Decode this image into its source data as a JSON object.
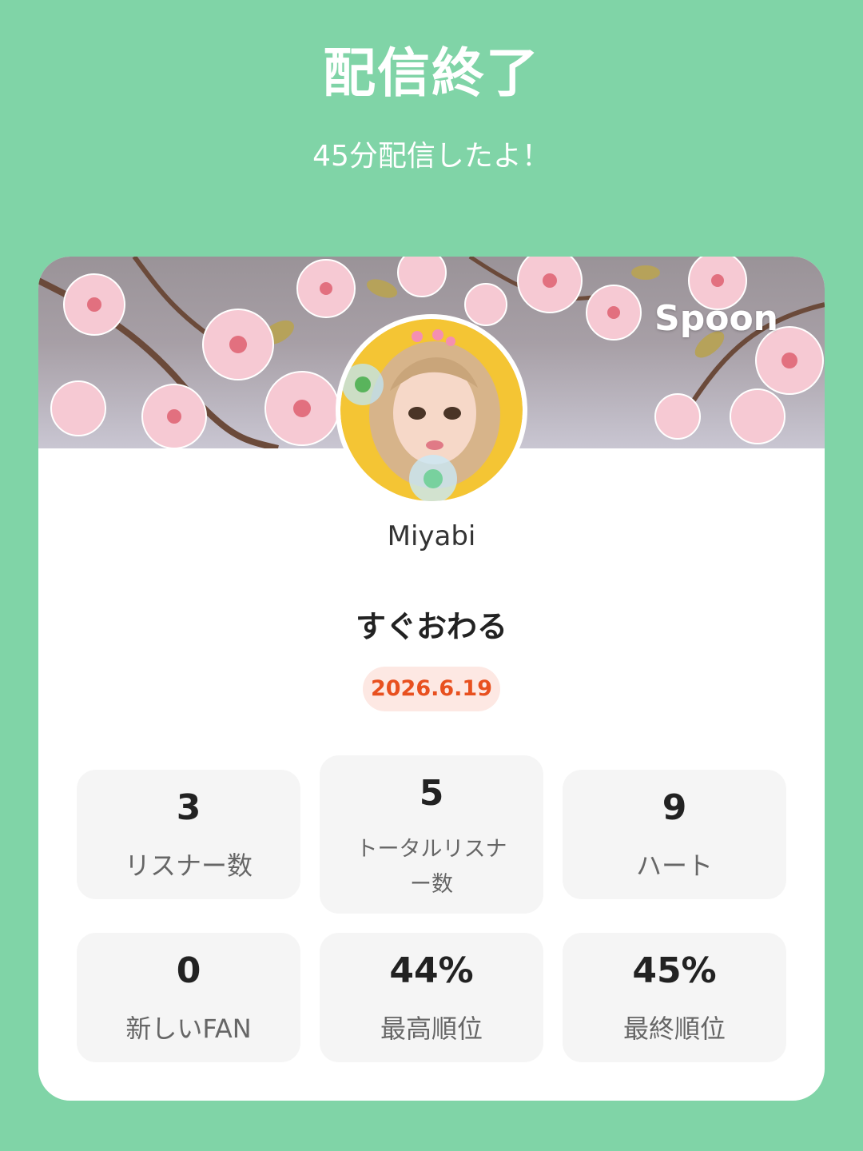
{
  "header": {
    "title": "配信終了",
    "subtitle": "45分配信したよ！"
  },
  "card": {
    "brand": "Spoon",
    "username": "Miyabi",
    "broadcast_title": "すぐおわる",
    "date": "2026.6.19",
    "stats": [
      {
        "value": "3",
        "label": "リスナー数"
      },
      {
        "value": "5",
        "label": "トータルリスナー数"
      },
      {
        "value": "9",
        "label": "ハート"
      },
      {
        "value": "0",
        "label": "新しいFAN"
      },
      {
        "value": "44%",
        "label": "最高順位"
      },
      {
        "value": "45%",
        "label": "最終順位"
      }
    ]
  },
  "colors": {
    "background": "#80d4a7",
    "card": "#ffffff",
    "stat_tile": "#f5f5f5",
    "date_badge_bg": "#fde8e3",
    "date_badge_text": "#e8501f"
  }
}
